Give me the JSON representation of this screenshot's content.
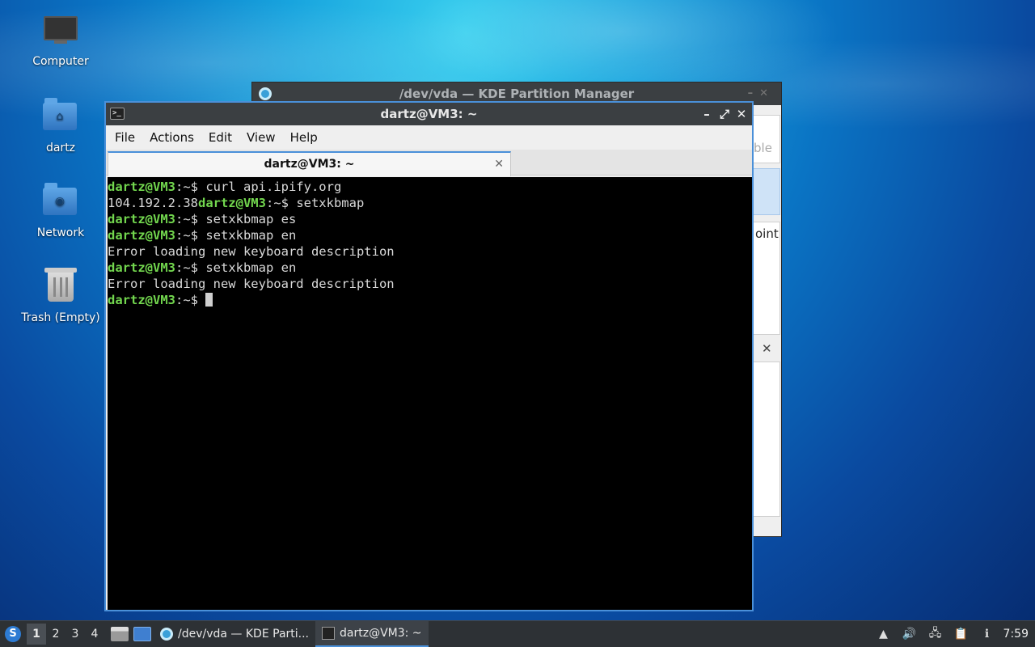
{
  "desktop": {
    "icons": [
      {
        "label": "Computer"
      },
      {
        "label": "dartz"
      },
      {
        "label": "Network"
      },
      {
        "label": "Trash (Empty)"
      }
    ]
  },
  "kde_window": {
    "title": "/dev/vda — KDE Partition Manager",
    "fragments": {
      "ble": "ble",
      "point": "oint"
    }
  },
  "terminal": {
    "title": "dartz@VM3: ~",
    "menu": [
      "File",
      "Actions",
      "Edit",
      "View",
      "Help"
    ],
    "tab_label": "dartz@VM3: ~",
    "prompt_user": "dartz@VM3",
    "prompt_path": ":~$ ",
    "lines": [
      {
        "type": "cmd",
        "text": "curl api.ipify.org"
      },
      {
        "type": "mixed",
        "output": "104.192.2.38",
        "text": "setxkbmap"
      },
      {
        "type": "cmd",
        "text": "setxkbmap es"
      },
      {
        "type": "cmd",
        "text": "setxkbmap en"
      },
      {
        "type": "out",
        "text": "Error loading new keyboard description"
      },
      {
        "type": "cmd",
        "text": "setxkbmap en"
      },
      {
        "type": "out",
        "text": "Error loading new keyboard description"
      },
      {
        "type": "prompt",
        "text": ""
      }
    ]
  },
  "taskbar": {
    "workspaces": [
      "1",
      "2",
      "3",
      "4"
    ],
    "active_workspace": "1",
    "tasks": [
      {
        "label": "/dev/vda — KDE Parti..."
      },
      {
        "label": "dartz@VM3: ~"
      }
    ],
    "clock": "7:59"
  },
  "colors": {
    "accent": "#4a90d9",
    "prompt_green": "#72d64e",
    "titlebar": "#3b3f42",
    "taskbar": "#2d3135"
  }
}
